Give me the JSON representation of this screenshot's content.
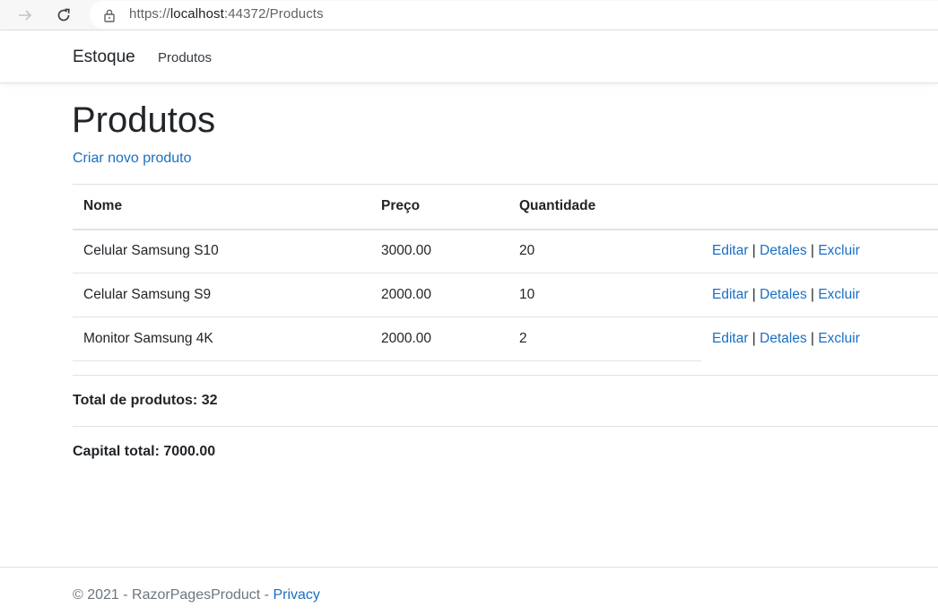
{
  "browser": {
    "url_prefix": "https://",
    "url_host": "localhost",
    "url_rest": ":44372/Products"
  },
  "navbar": {
    "brand": "Estoque",
    "link_products": "Produtos"
  },
  "main": {
    "title": "Produtos",
    "create_link": "Criar novo produto",
    "table": {
      "headers": {
        "name": "Nome",
        "price": "Preço",
        "quantity": "Quantidade"
      },
      "rows": [
        {
          "name": "Celular Samsung S10",
          "price": "3000.00",
          "quantity": "20"
        },
        {
          "name": "Celular Samsung S9",
          "price": "2000.00",
          "quantity": "10"
        },
        {
          "name": "Monitor Samsung 4K",
          "price": "2000.00",
          "quantity": "2"
        }
      ],
      "actions": {
        "edit": "Editar",
        "details": "Detales",
        "delete": "Excluir",
        "separator": " | "
      }
    },
    "total_products": "Total de produtos: 32",
    "total_capital": "Capital total: 7000.00"
  },
  "footer": {
    "copyright": "© 2021 - RazorPagesProduct - ",
    "privacy": "Privacy"
  },
  "colors": {
    "link": "#1b6ec2",
    "text": "#212529",
    "border": "#dee2e6",
    "footer_text": "#6c757d"
  }
}
